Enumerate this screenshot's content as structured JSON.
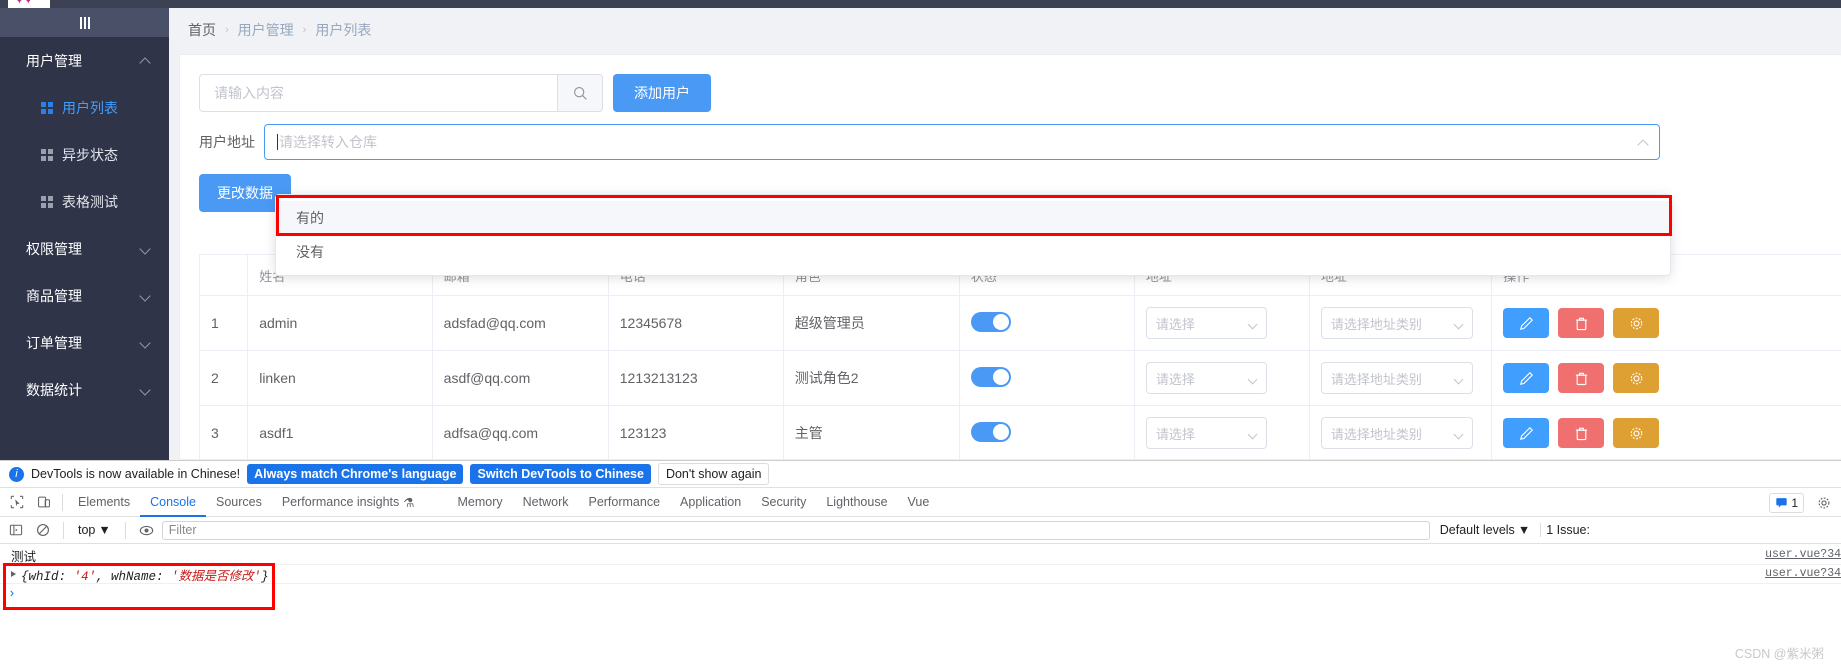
{
  "browser": {
    "tab_glyph": "✦"
  },
  "sidebar": {
    "toggle_icon": "hamburger-icon",
    "groups": [
      {
        "label": "用户管理",
        "expanded": true,
        "items": [
          {
            "label": "用户列表",
            "active": true
          },
          {
            "label": "异步状态",
            "active": false
          },
          {
            "label": "表格测试",
            "active": false
          }
        ]
      },
      {
        "label": "权限管理",
        "expanded": false,
        "items": []
      },
      {
        "label": "商品管理",
        "expanded": false,
        "items": []
      },
      {
        "label": "订单管理",
        "expanded": false,
        "items": []
      },
      {
        "label": "数据统计",
        "expanded": false,
        "items": []
      }
    ]
  },
  "breadcrumb": {
    "items": [
      "首页",
      "用户管理",
      "用户列表"
    ],
    "separator": "›"
  },
  "toolbar": {
    "search_placeholder": "请输入内容",
    "search_value": "",
    "search_icon": "search-icon",
    "add_user_label": "添加用户",
    "change_data_label": "更改数据"
  },
  "address_field": {
    "label": "用户地址",
    "placeholder": "请选择转入仓库",
    "value": ""
  },
  "dropdown": {
    "options": [
      "有的",
      "没有"
    ],
    "hovered_index": 0,
    "highlight_color": "#ff0000"
  },
  "table": {
    "columns": [
      "",
      "姓名",
      "邮箱",
      "电话",
      "角色",
      "状态",
      "地址",
      "地址",
      "操作"
    ],
    "address_placeholder_1": "请选择",
    "address_placeholder_2": "请选择地址类别",
    "rows": [
      {
        "index": "1",
        "name": "admin",
        "email": "adsfad@qq.com",
        "phone": "12345678",
        "role": "超级管理员",
        "status_on": true
      },
      {
        "index": "2",
        "name": "linken",
        "email": "asdf@qq.com",
        "phone": "1213213123",
        "role": "测试角色2",
        "status_on": true
      },
      {
        "index": "3",
        "name": "asdf1",
        "email": "adfsa@qq.com",
        "phone": "123123",
        "role": "主管",
        "status_on": true
      }
    ],
    "action_icons": [
      "pencil-icon",
      "trash-icon",
      "gear-icon"
    ],
    "action_colors": [
      "#409eff",
      "#f07070",
      "#dfa033"
    ]
  },
  "devtools": {
    "banner": {
      "message": "DevTools is now available in Chinese!",
      "info_icon": "info-icon",
      "buttons": [
        {
          "label": "Always match Chrome's language",
          "style": "blue"
        },
        {
          "label": "Switch DevTools to Chinese",
          "style": "blue"
        },
        {
          "label": "Don't show again",
          "style": "white"
        }
      ]
    },
    "tabs": [
      {
        "label": "Elements",
        "active": false
      },
      {
        "label": "Console",
        "active": true
      },
      {
        "label": "Sources",
        "active": false
      },
      {
        "label": "Performance insights",
        "active": false,
        "badge": "⚗"
      },
      {
        "label": "Memory",
        "active": false
      },
      {
        "label": "Network",
        "active": false
      },
      {
        "label": "Performance",
        "active": false
      },
      {
        "label": "Application",
        "active": false
      },
      {
        "label": "Security",
        "active": false
      },
      {
        "label": "Lighthouse",
        "active": false
      },
      {
        "label": "Vue",
        "active": false
      }
    ],
    "inspect_icon": "inspect-element-icon",
    "device_icon": "device-toolbar-icon",
    "message_badge": "1",
    "settings_icon": "gear-icon",
    "filterbar": {
      "sidebar_icon": "console-sidebar-icon",
      "clear_icon": "clear-console-icon",
      "context": "top",
      "eye_icon": "live-expression-icon",
      "filter_placeholder": "Filter",
      "filter_value": "",
      "levels": "Default levels",
      "issues": "1 Issue:"
    },
    "console": {
      "entries": [
        {
          "text": "测试",
          "source": "user.vue?34",
          "expandable": false
        },
        {
          "text": "{whId: '4', whName: '数据是否修改'}",
          "source": "user.vue?34",
          "expandable": true
        }
      ],
      "prompt": "›",
      "highlight_color": "#ff0000"
    }
  },
  "watermark": {
    "text": "CSDN @紫米粥"
  }
}
